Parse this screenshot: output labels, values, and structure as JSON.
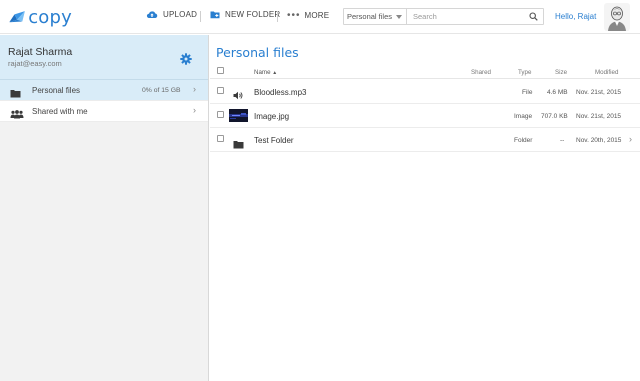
{
  "app": {
    "logo_text": "copy",
    "brand_color": "#2a7fd0"
  },
  "header": {
    "upload_label": "UPLOAD",
    "new_folder_label": "NEW FOLDER",
    "more_label": "MORE",
    "search_scope": "Personal files",
    "search_placeholder": "Search",
    "greeting": "Hello, Rajat"
  },
  "sidebar": {
    "user_name": "Rajat Sharma",
    "user_email": "rajat@easy.com",
    "items": [
      {
        "label": "Personal files",
        "quota": "0% of 15 GB",
        "icon": "folder-icon",
        "active": true
      },
      {
        "label": "Shared with me",
        "quota": "",
        "icon": "people-icon",
        "active": false
      }
    ]
  },
  "main": {
    "title": "Personal files",
    "columns": {
      "name": "Name",
      "shared": "Shared",
      "type": "Type",
      "size": "Size",
      "modified": "Modified"
    },
    "sort_indicator": "▲",
    "rows": [
      {
        "name": "Bloodless.mp3",
        "shared": "",
        "type": "File",
        "size": "4.6 MB",
        "modified": "Nov. 21st, 2015",
        "icon": "audio-icon"
      },
      {
        "name": "Image.jpg",
        "shared": "",
        "type": "Image",
        "size": "707.0 KB",
        "modified": "Nov. 21st, 2015",
        "icon": "image-thumbnail"
      },
      {
        "name": "Test Folder",
        "shared": "",
        "type": "Folder",
        "size": "--",
        "modified": "Nov. 20th, 2015",
        "icon": "folder-icon"
      }
    ]
  }
}
